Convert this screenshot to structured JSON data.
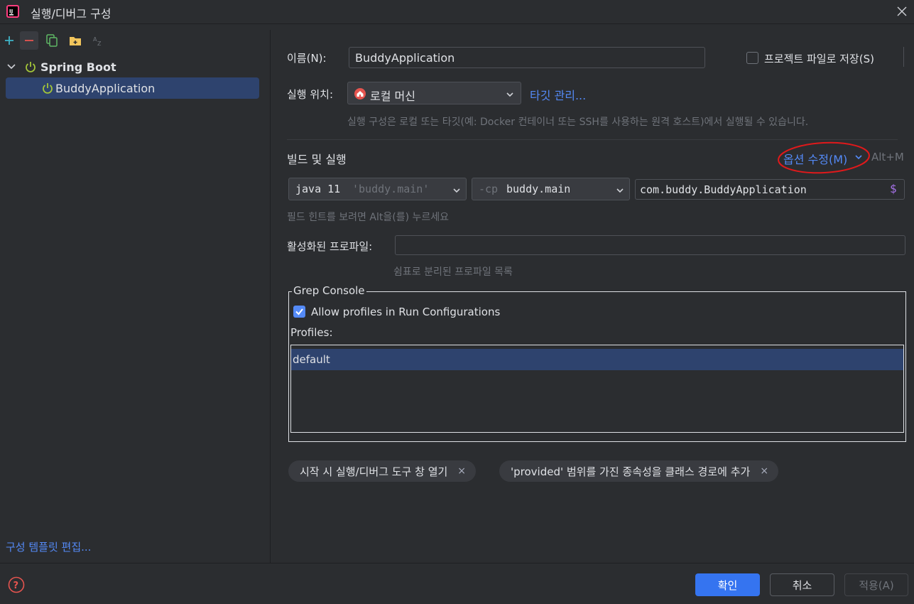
{
  "window": {
    "title": "실행/디버그 구성",
    "icons": {
      "app": "intellij-icon",
      "close": "close-icon"
    }
  },
  "sidebar": {
    "toolbar": [
      {
        "name": "add-icon",
        "color": "#3fb5c9"
      },
      {
        "name": "remove-icon",
        "color": "#e5544f"
      },
      {
        "name": "copy-icon",
        "color": "#5fb865"
      },
      {
        "name": "new-folder-icon",
        "color": "#f2c55c"
      },
      {
        "name": "sort-az-icon",
        "color": "#6f737a"
      }
    ],
    "tree": {
      "group_label": "Spring Boot",
      "item_label": "BuddyApplication"
    },
    "edit_templates": "구성 템플릿 편집..."
  },
  "form": {
    "name_label": "이름(N):",
    "name_value": "BuddyApplication",
    "store_as_file_label": "프로젝트 파일로 저장(S)",
    "store_as_file_checked": false,
    "run_on_label": "실행 위치:",
    "run_on_value": "로컬 머신",
    "manage_targets": "타깃 관리...",
    "run_on_hint": "실행 구성은 로컬 또는 타깃(예: Docker 컨테이너 또는 SSH를 사용하는 원격 호스트)에서 실행될 수 있습니다.",
    "build_run_label": "빌드 및 실행",
    "modify_options": "옵션 수정(M)",
    "modify_shortcut": "Alt+M",
    "jre_keyword": "java 11",
    "jre_module": "'buddy.main'",
    "cp_flag": "-cp",
    "cp_value": "buddy.main",
    "main_class": "com.buddy.BuddyApplication",
    "field_hint": "필드 힌트를 보려면 Alt을(를) 누르세요",
    "active_profiles_label": "활성화된 프로파일:",
    "active_profiles_value": "",
    "active_profiles_hint": "쉼표로 분리된 프로파일 목록"
  },
  "grep_console": {
    "title": "Grep Console",
    "allow_label": "Allow profiles in Run Configurations",
    "allow_checked": true,
    "profiles_label": "Profiles:",
    "profiles": [
      "default"
    ]
  },
  "chips": [
    {
      "label": "시작 시 실행/디버그 도구 창 열기",
      "close": "×"
    },
    {
      "label": "'provided' 범위를 가진 종속성을 클래스 경로에 추가",
      "close": "×"
    }
  ],
  "footer": {
    "ok": "확인",
    "cancel": "취소",
    "apply": "적용(A)",
    "help_icon": "help-icon"
  },
  "colors": {
    "background": "#2b2d30",
    "selection": "#2e436e",
    "accent": "#548af7",
    "spring_green": "#a4c639",
    "annotation_red": "#e0191b"
  }
}
